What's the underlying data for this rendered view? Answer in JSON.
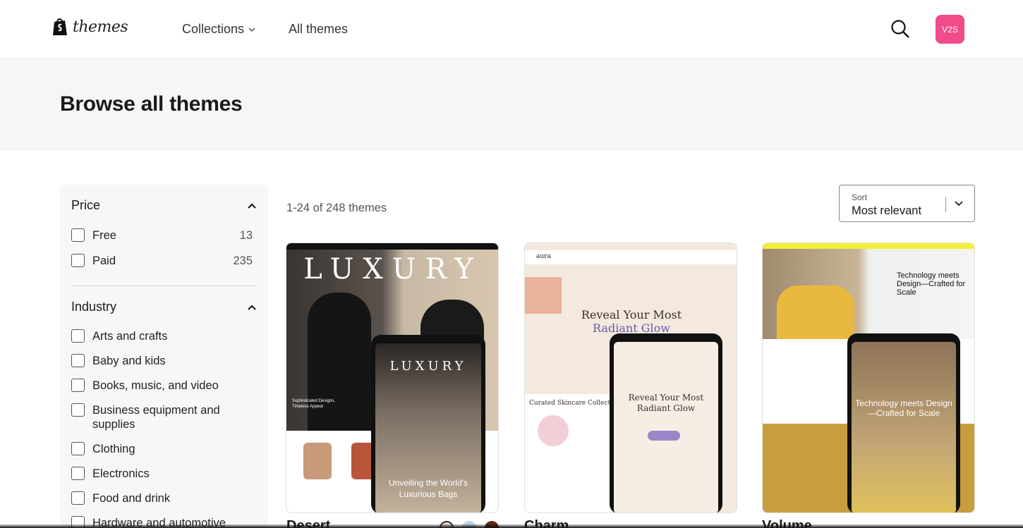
{
  "nav": {
    "logo_text": "themes",
    "collections_label": "Collections",
    "all_themes_label": "All themes",
    "avatar_text": "V2S",
    "avatar_color": "#f14b8a"
  },
  "hero": {
    "title": "Browse all themes"
  },
  "filters": {
    "price": {
      "title": "Price",
      "options": [
        {
          "label": "Free",
          "count": "13"
        },
        {
          "label": "Paid",
          "count": "235"
        }
      ]
    },
    "industry": {
      "title": "Industry",
      "options": [
        {
          "label": "Arts and crafts"
        },
        {
          "label": "Baby and kids"
        },
        {
          "label": "Books, music, and video"
        },
        {
          "label": "Business equipment and supplies"
        },
        {
          "label": "Clothing"
        },
        {
          "label": "Electronics"
        },
        {
          "label": "Food and drink"
        },
        {
          "label": "Hardware and automotive"
        }
      ]
    }
  },
  "results": {
    "count_text": "1-24 of 248 themes",
    "sort_label": "Sort",
    "sort_value": "Most relevant"
  },
  "themes": [
    {
      "name": "Desert",
      "preview_headline": "LUXURY",
      "preview_caption": "Unveiling the World's Luxurious Bags",
      "preview_tagline": "Sophisticated Designs, Timeless Appeal"
    },
    {
      "name": "Charm",
      "preview_brand": "aura",
      "preview_headline_a": "Reveal Your Most",
      "preview_headline_b": "Radiant Glow",
      "preview_section": "Curated Skincare Collections"
    },
    {
      "name": "Volume",
      "preview_headline": "Technology meets Design—Crafted for Scale"
    }
  ]
}
